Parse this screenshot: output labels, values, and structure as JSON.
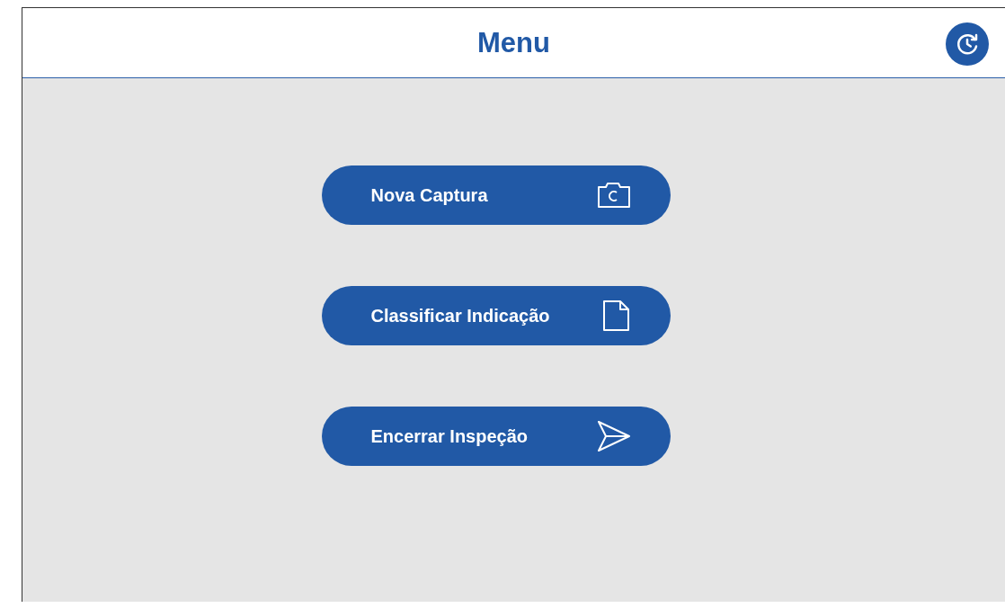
{
  "header": {
    "title": "Menu"
  },
  "menu_items": [
    {
      "label": "Nova Captura",
      "kind": "camera"
    },
    {
      "label": "Classificar Indicação",
      "kind": "document"
    },
    {
      "label": "Encerrar Inspeção",
      "kind": "send"
    }
  ]
}
